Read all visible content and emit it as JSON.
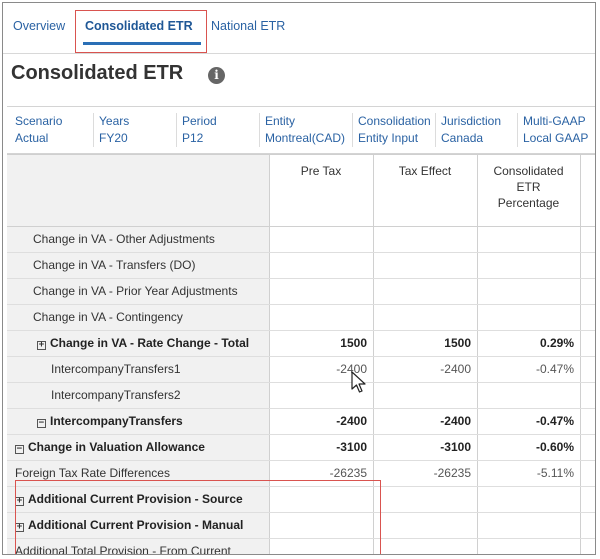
{
  "tabs": [
    {
      "label": "Overview",
      "active": false
    },
    {
      "label": "Consolidated ETR",
      "active": true
    },
    {
      "label": "National ETR",
      "active": false
    }
  ],
  "page_title": "Consolidated ETR",
  "info_icon": "i",
  "pov": [
    {
      "label": "Scenario",
      "value": "Actual"
    },
    {
      "label": "Years",
      "value": "FY20"
    },
    {
      "label": "Period",
      "value": "P12"
    },
    {
      "label": "Entity",
      "value": "Montreal(CAD)"
    },
    {
      "label": "Consolidation",
      "value": "Entity Input"
    },
    {
      "label": "Jurisdiction",
      "value": "Canada"
    },
    {
      "label": "Multi-GAAP",
      "value": "Local GAAP"
    }
  ],
  "grid": {
    "columns": [
      "Pre Tax",
      "Tax Effect",
      "Consolidated ETR Percentage"
    ],
    "column_lines": [
      "Consolidated",
      "ETR",
      "Percentage"
    ],
    "rows": [
      {
        "label": "Change in VA - Other Adjustments",
        "pre_tax": "",
        "tax_effect": "",
        "etr": ""
      },
      {
        "label": "Change in VA - Transfers (DO)",
        "pre_tax": "",
        "tax_effect": "",
        "etr": ""
      },
      {
        "label": "Change in VA - Prior Year Adjustments",
        "pre_tax": "",
        "tax_effect": "",
        "etr": ""
      },
      {
        "label": "Change in VA - Contingency",
        "pre_tax": "",
        "tax_effect": "",
        "etr": ""
      },
      {
        "label": "Change in VA - Rate Change - Total",
        "expander": "+",
        "pre_tax": "1500",
        "tax_effect": "1500",
        "etr": "0.29%"
      },
      {
        "label": "IntercompanyTransfers1",
        "pre_tax": "-2400",
        "tax_effect": "-2400",
        "etr": "-0.47%"
      },
      {
        "label": "IntercompanyTransfers2",
        "pre_tax": "",
        "tax_effect": "",
        "etr": ""
      },
      {
        "label": "IntercompanyTransfers",
        "expander": "−",
        "pre_tax": "-2400",
        "tax_effect": "-2400",
        "etr": "-0.47%"
      },
      {
        "label": "Change in Valuation Allowance",
        "expander": "−",
        "pre_tax": "-3100",
        "tax_effect": "-3100",
        "etr": "-0.60%"
      },
      {
        "label": "Foreign Tax Rate Differences",
        "pre_tax": "-26235",
        "tax_effect": "-26235",
        "etr": "-5.11%"
      },
      {
        "label": "Additional Current Provision - Source",
        "expander": "+",
        "pre_tax": "",
        "tax_effect": "",
        "etr": ""
      },
      {
        "label": "Additional Current Provision - Manual",
        "expander": "+",
        "pre_tax": "",
        "tax_effect": "",
        "etr": ""
      },
      {
        "label": "Additional Total Provision - From Current",
        "pre_tax": "",
        "tax_effect": "",
        "etr": ""
      }
    ]
  },
  "colors": {
    "accent": "#2a62a3",
    "highlight": "#d9534f",
    "column_bg": "#f1f1f1"
  }
}
